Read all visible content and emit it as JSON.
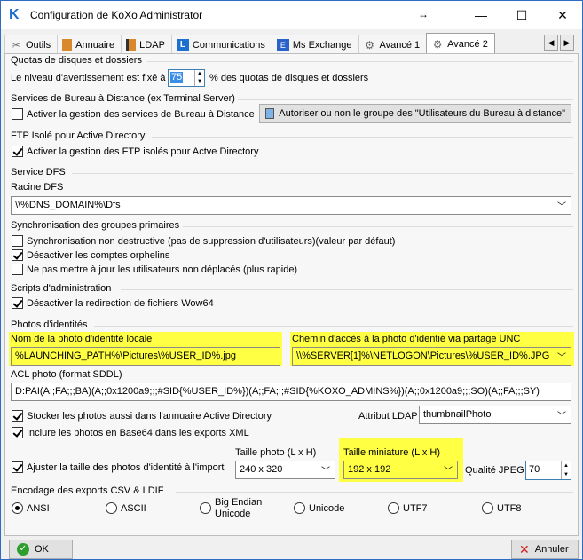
{
  "window": {
    "title": "Configuration de KoXo Administrator",
    "logo_letter": "K",
    "resize_glyph": "↔",
    "minimize": "—",
    "maximize": "☐",
    "close": "✕"
  },
  "tabs": [
    {
      "label": "Outils",
      "icon": "tools-icon",
      "glyph": "✂"
    },
    {
      "label": "Annuaire",
      "icon": "book-icon",
      "glyph": "📙"
    },
    {
      "label": "LDAP",
      "icon": "folder-book-icon",
      "glyph": "📘"
    },
    {
      "label": "Communications",
      "icon": "communications-icon",
      "glyph": "🅛"
    },
    {
      "label": "Ms Exchange",
      "icon": "exchange-icon",
      "glyph": "✉"
    },
    {
      "label": "Avancé 1",
      "icon": "gear-icon",
      "glyph": "⚙"
    },
    {
      "label": "Avancé 2",
      "icon": "gear-icon",
      "glyph": "⚙",
      "active": true
    }
  ],
  "tab_scroll": {
    "left": "◀",
    "right": "▶"
  },
  "quotas": {
    "title": "Quotas de disques et dossiers",
    "label_before": "Le niveau d'avertissement est fixé à",
    "value": "75",
    "label_after": "% des quotas de disques et dossiers"
  },
  "rds": {
    "title": "Services de Bureau à Distance (ex Terminal Server)",
    "checkbox_label": "Activer la gestion des services de Bureau à Distance",
    "checked": false,
    "button_label": "Autoriser ou non le groupe des \"Utilisateurs du Bureau à distance\""
  },
  "ftp": {
    "title": "FTP Isolé pour Active Directory",
    "checkbox_label": "Activer la gestion des FTP isolés pour Actve Directory",
    "checked": true
  },
  "dfs": {
    "title": "Service DFS",
    "root_label": "Racine DFS",
    "root_value": "\\\\%DNS_DOMAIN%\\Dfs"
  },
  "sync": {
    "title": "Synchronisation des groupes primaires",
    "options": [
      {
        "label": "Synchronisation non destructive (pas de suppression d'utilisateurs)(valeur par défaut)",
        "checked": false
      },
      {
        "label": "Désactiver les comptes orphelins",
        "checked": true
      },
      {
        "label": "Ne pas mettre à jour les utilisateurs non déplacés (plus rapide)",
        "checked": false
      }
    ]
  },
  "scripts": {
    "title": "Scripts d'administration",
    "checkbox_label": "Désactiver la redirection de fichiers Wow64",
    "checked": true
  },
  "photos": {
    "title": "Photos d'identités",
    "local_label": "Nom de la photo d'identité locale",
    "local_value": "%LAUNCHING_PATH%\\Pictures\\%USER_ID%.jpg",
    "unc_label": "Chemin d'accès à la photo d'identié via partage UNC",
    "unc_value": "\\\\%SERVER[1]%\\NETLOGON\\Pictures\\%USER_ID%.JPG",
    "acl_label": "ACL photo (format SDDL)",
    "acl_value": "D:PAI(A;;FA;;;BA)(A;;0x1200a9;;;#SID{%USER_ID%})(A;;FA;;;#SID{%KOXO_ADMINS%})(A;;0x1200a9;;;SO)(A;;FA;;;SY)",
    "store_ad_label": "Stocker les photos aussi dans l'annuaire Active Directory",
    "store_ad_checked": true,
    "ldap_attr_label": "Attribut LDAP",
    "ldap_attr_value": "thumbnailPhoto",
    "base64_label": "Inclure les photos en Base64 dans les exports XML",
    "base64_checked": true,
    "resize_label": "Ajuster la taille des photos d'identité à l'import",
    "resize_checked": true,
    "size_label": "Taille photo (L x H)",
    "size_value": "240 x 320",
    "thumb_label": "Taille miniature (L x H)",
    "thumb_value": "192 x 192",
    "jpeg_label": "Qualité JPEG",
    "jpeg_value": "70"
  },
  "encoding": {
    "title": "Encodage des exports CSV & LDIF",
    "options": [
      {
        "label": "ANSI",
        "checked": true
      },
      {
        "label": "ASCII",
        "checked": false
      },
      {
        "label": "Big Endian",
        "label2": "Unicode",
        "checked": false
      },
      {
        "label": "Unicode",
        "checked": false
      },
      {
        "label": "UTF7",
        "checked": false
      },
      {
        "label": "UTF8",
        "checked": false
      }
    ]
  },
  "footer": {
    "ok_label": "OK",
    "cancel_label": "Annuler"
  },
  "colors": {
    "highlight": "#ffff44",
    "ok_icon": "#2e9e2e",
    "cancel_icon": "#d02020",
    "accent": "#1d6fd0"
  }
}
